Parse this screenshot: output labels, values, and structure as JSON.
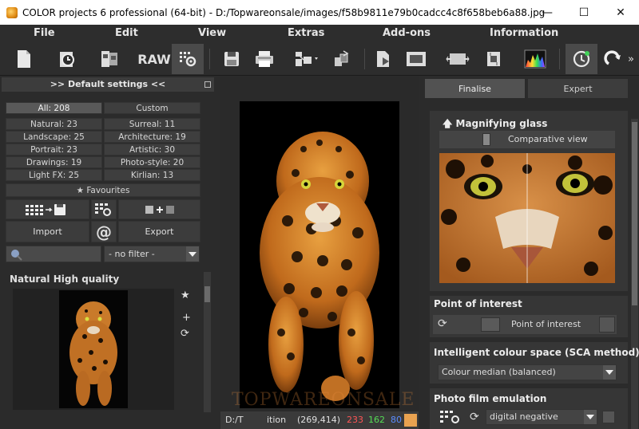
{
  "window": {
    "title": "COLOR projects 6 professional (64-bit) - D:/Topwareonsale/images/f58b9811e79b0cadcc4c8f658beb6a88.jpg",
    "minimize": "—",
    "maximize": "☐",
    "close": "✕"
  },
  "menu": [
    "File",
    "Edit",
    "View",
    "Extras",
    "Add-ons",
    "Information"
  ],
  "toolbar": {
    "raw_label": "RAW",
    "overflow": "»",
    "icons": [
      "new-document-icon",
      "history-icon",
      "compare-images-icon",
      "raw-icon",
      "settings-grid-icon",
      "save-icon",
      "print-icon",
      "export-menu-icon",
      "batch-icon",
      "open-in-editor-icon",
      "frame-icon",
      "resize-icon",
      "crop-icon",
      "histogram-icon",
      "auto-enhance-icon",
      "redo-icon"
    ]
  },
  "left_panel": {
    "header": ">> Default settings <<",
    "categories": [
      {
        "label": "All: 208",
        "selected": true
      },
      {
        "label": "Custom",
        "selected": false
      },
      {
        "label": "Natural: 23",
        "selected": false
      },
      {
        "label": "Surreal: 11",
        "selected": false
      },
      {
        "label": "Landscape: 25",
        "selected": false
      },
      {
        "label": "Architecture: 19",
        "selected": false
      },
      {
        "label": "Portrait: 23",
        "selected": false
      },
      {
        "label": "Artistic: 30",
        "selected": false
      },
      {
        "label": "Drawings: 19",
        "selected": false
      },
      {
        "label": "Photo-style: 20",
        "selected": false
      },
      {
        "label": "Light FX: 25",
        "selected": false
      },
      {
        "label": "Kirlian: 13",
        "selected": false
      }
    ],
    "favourites": "Favourites",
    "import_label": "Import",
    "at_label": "@",
    "export_label": "Export",
    "filter": "- no filter -",
    "section_title": "Natural High quality"
  },
  "center": {
    "watermark": "TOPWAREONSALE",
    "status": {
      "path": "D:/T",
      "mode": "ition",
      "coords": "(269,414)",
      "r": "233",
      "g": "162",
      "b": "80",
      "swatch_color": "#e9a250"
    }
  },
  "right_panel": {
    "tabs": [
      {
        "label": "Finalise",
        "active": true
      },
      {
        "label": "Expert",
        "active": false
      }
    ],
    "magnifier": {
      "title": "Magnifying glass",
      "compare_label": "Comparative view"
    },
    "poi": {
      "title": "Point of interest",
      "label": "Point of interest"
    },
    "sca": {
      "title": "Intelligent colour space (SCA method)",
      "value": "Colour median (balanced)"
    },
    "film": {
      "title": "Photo film emulation",
      "value": "digital negative"
    }
  },
  "colors": {
    "background": "#2b2b2b",
    "panel": "#363636",
    "button": "#3c3c3c",
    "status_red": "#ff5555",
    "status_green": "#55dd55",
    "status_blue": "#5a8cff"
  }
}
